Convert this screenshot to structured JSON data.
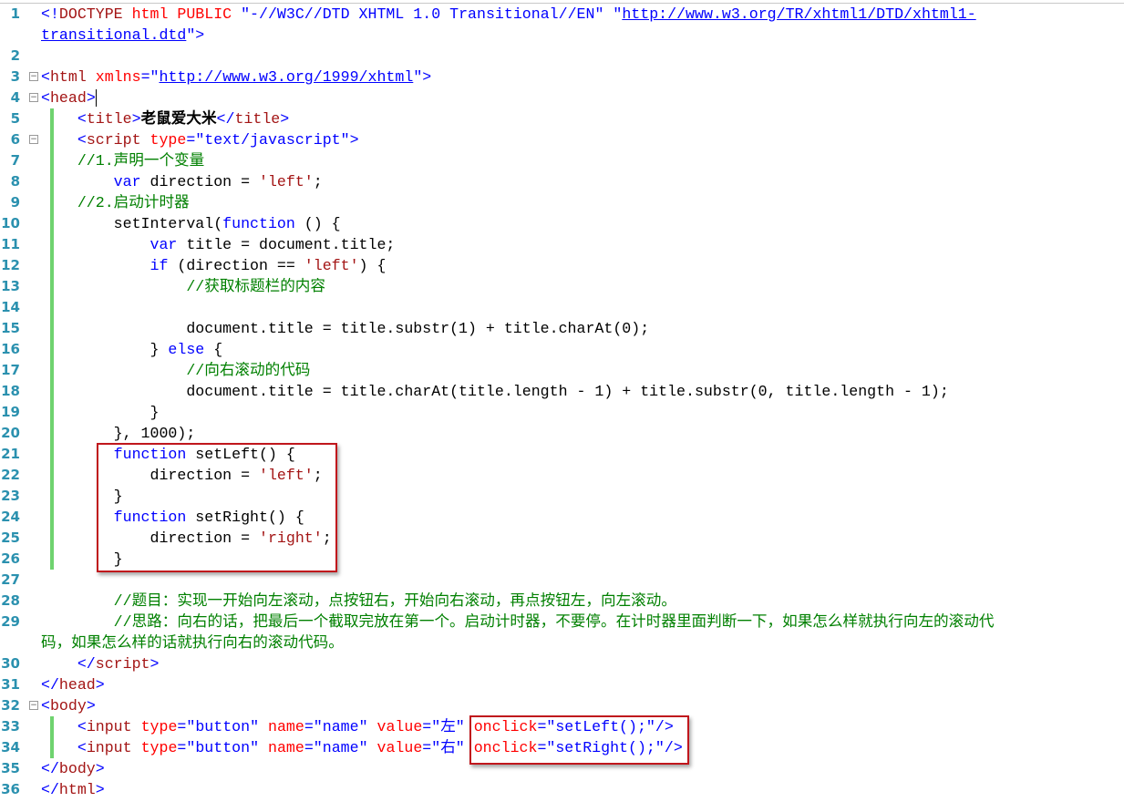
{
  "editor": {
    "lines": [
      {
        "n": "1",
        "rows": [
          [
            [
              "t",
              "<!"
            ],
            [
              "tn",
              "DOCTYPE"
            ],
            [
              "an",
              " html PUBLIC"
            ],
            [
              "av",
              " \"-//W3C//DTD XHTML 1.0 Transitional//EN\" \""
            ],
            [
              "url",
              "http://www.w3.org/TR/xhtml1/DTD/xhtml1-"
            ]
          ],
          [
            [
              "url",
              "transitional.dtd"
            ],
            [
              "av",
              "\""
            ],
            [
              "t",
              ">"
            ]
          ]
        ]
      },
      {
        "n": "2",
        "rows": [
          []
        ]
      },
      {
        "n": "3",
        "fold": true,
        "rows": [
          [
            [
              "t",
              "<"
            ],
            [
              "tn",
              "html"
            ],
            [
              "an",
              " xmlns"
            ],
            [
              "av",
              "=\""
            ],
            [
              "url",
              "http://www.w3.org/1999/xhtml"
            ],
            [
              "av",
              "\""
            ],
            [
              "t",
              ">"
            ]
          ]
        ]
      },
      {
        "n": "4",
        "fold": true,
        "caret": true,
        "rows": [
          [
            [
              "t",
              "<"
            ],
            [
              "tn",
              "head"
            ],
            [
              "t",
              ">"
            ]
          ]
        ]
      },
      {
        "n": "5",
        "chg": true,
        "rows": [
          [
            [
              "p",
              "    "
            ],
            [
              "t",
              "<"
            ],
            [
              "tn",
              "title"
            ],
            [
              "t",
              ">"
            ],
            [
              "b",
              "老鼠爱大米"
            ],
            [
              "t",
              "</"
            ],
            [
              "tn",
              "title"
            ],
            [
              "t",
              ">"
            ]
          ]
        ]
      },
      {
        "n": "6",
        "chg": true,
        "fold": true,
        "rows": [
          [
            [
              "p",
              "    "
            ],
            [
              "t",
              "<"
            ],
            [
              "tn",
              "script"
            ],
            [
              "an",
              " type"
            ],
            [
              "av",
              "=\"text/javascript\""
            ],
            [
              "t",
              ">"
            ]
          ]
        ]
      },
      {
        "n": "7",
        "chg": true,
        "rows": [
          [
            [
              "p",
              "    "
            ],
            [
              "c",
              "//1.声明一个变量"
            ]
          ]
        ]
      },
      {
        "n": "8",
        "chg": true,
        "rows": [
          [
            [
              "p",
              "        "
            ],
            [
              "kw",
              "var"
            ],
            [
              "p",
              " direction = "
            ],
            [
              "s",
              "'left'"
            ],
            [
              "p",
              ";"
            ]
          ]
        ]
      },
      {
        "n": "9",
        "chg": true,
        "rows": [
          [
            [
              "p",
              "    "
            ],
            [
              "c",
              "//2.启动计时器"
            ]
          ]
        ]
      },
      {
        "n": "10",
        "chg": true,
        "rows": [
          [
            [
              "p",
              "        setInterval("
            ],
            [
              "kw",
              "function"
            ],
            [
              "p",
              " () {"
            ]
          ]
        ]
      },
      {
        "n": "11",
        "chg": true,
        "rows": [
          [
            [
              "p",
              "            "
            ],
            [
              "kw",
              "var"
            ],
            [
              "p",
              " title = document.title;"
            ]
          ]
        ]
      },
      {
        "n": "12",
        "chg": true,
        "rows": [
          [
            [
              "p",
              "            "
            ],
            [
              "kw",
              "if"
            ],
            [
              "p",
              " (direction == "
            ],
            [
              "s",
              "'left'"
            ],
            [
              "p",
              ") {"
            ]
          ]
        ]
      },
      {
        "n": "13",
        "chg": true,
        "rows": [
          [
            [
              "p",
              "                "
            ],
            [
              "c",
              "//获取标题栏的内容"
            ]
          ]
        ]
      },
      {
        "n": "14",
        "chg": true,
        "rows": [
          []
        ]
      },
      {
        "n": "15",
        "chg": true,
        "rows": [
          [
            [
              "p",
              "                document.title = title.substr(1) + title.charAt(0);"
            ]
          ]
        ]
      },
      {
        "n": "16",
        "chg": true,
        "rows": [
          [
            [
              "p",
              "            } "
            ],
            [
              "kw",
              "else"
            ],
            [
              "p",
              " {"
            ]
          ]
        ]
      },
      {
        "n": "17",
        "chg": true,
        "rows": [
          [
            [
              "p",
              "                "
            ],
            [
              "c",
              "//向右滚动的代码"
            ]
          ]
        ]
      },
      {
        "n": "18",
        "chg": true,
        "rows": [
          [
            [
              "p",
              "                document.title = title.charAt(title.length - 1) + title.substr(0, title.length - 1);"
            ]
          ]
        ]
      },
      {
        "n": "19",
        "chg": true,
        "rows": [
          [
            [
              "p",
              "            }"
            ]
          ]
        ]
      },
      {
        "n": "20",
        "chg": true,
        "rows": [
          [
            [
              "p",
              "        }, 1000);"
            ]
          ]
        ]
      },
      {
        "n": "21",
        "chg": true,
        "rows": [
          [
            [
              "p",
              "        "
            ],
            [
              "kw",
              "function"
            ],
            [
              "p",
              " setLeft() {"
            ]
          ]
        ]
      },
      {
        "n": "22",
        "chg": true,
        "rows": [
          [
            [
              "p",
              "            direction = "
            ],
            [
              "s",
              "'left'"
            ],
            [
              "p",
              ";"
            ]
          ]
        ]
      },
      {
        "n": "23",
        "chg": true,
        "rows": [
          [
            [
              "p",
              "        }"
            ]
          ]
        ]
      },
      {
        "n": "24",
        "chg": true,
        "rows": [
          [
            [
              "p",
              "        "
            ],
            [
              "kw",
              "function"
            ],
            [
              "p",
              " setRight() {"
            ]
          ]
        ]
      },
      {
        "n": "25",
        "chg": true,
        "rows": [
          [
            [
              "p",
              "            direction = "
            ],
            [
              "s",
              "'right'"
            ],
            [
              "p",
              ";"
            ]
          ]
        ]
      },
      {
        "n": "26",
        "chg": true,
        "rows": [
          [
            [
              "p",
              "        }"
            ]
          ]
        ]
      },
      {
        "n": "27",
        "rows": [
          []
        ]
      },
      {
        "n": "28",
        "rows": [
          [
            [
              "p",
              "        "
            ],
            [
              "c",
              "//题目：实现一开始向左滚动，点按钮右，开始向右滚动，再点按钮左，向左滚动。"
            ]
          ]
        ]
      },
      {
        "n": "29",
        "rows": [
          [
            [
              "p",
              "        "
            ],
            [
              "c",
              "//思路：向右的话，把最后一个截取完放在第一个。启动计时器，不要停。在计时器里面判断一下，如果怎么样就执行向左的滚动代"
            ]
          ],
          [
            [
              "c",
              "码，如果怎么样的话就执行向右的滚动代码。"
            ]
          ]
        ]
      },
      {
        "n": "30",
        "rows": [
          [
            [
              "p",
              "    "
            ],
            [
              "t",
              "</"
            ],
            [
              "tn",
              "script"
            ],
            [
              "t",
              ">"
            ]
          ]
        ]
      },
      {
        "n": "31",
        "rows": [
          [
            [
              "t",
              "</"
            ],
            [
              "tn",
              "head"
            ],
            [
              "t",
              ">"
            ]
          ]
        ]
      },
      {
        "n": "32",
        "fold": true,
        "rows": [
          [
            [
              "t",
              "<"
            ],
            [
              "tn",
              "body"
            ],
            [
              "t",
              ">"
            ]
          ]
        ]
      },
      {
        "n": "33",
        "chg": true,
        "rows": [
          [
            [
              "p",
              "    "
            ],
            [
              "t",
              "<"
            ],
            [
              "tn",
              "input"
            ],
            [
              "an",
              " type"
            ],
            [
              "av",
              "=\"button\""
            ],
            [
              "an",
              " name"
            ],
            [
              "av",
              "=\"name\""
            ],
            [
              "an",
              " value"
            ],
            [
              "av",
              "=\"左\""
            ],
            [
              "an",
              " onclick"
            ],
            [
              "av",
              "=\"setLeft();\""
            ],
            [
              "t",
              "/>"
            ]
          ]
        ]
      },
      {
        "n": "34",
        "chg": true,
        "rows": [
          [
            [
              "p",
              "    "
            ],
            [
              "t",
              "<"
            ],
            [
              "tn",
              "input"
            ],
            [
              "an",
              " type"
            ],
            [
              "av",
              "=\"button\""
            ],
            [
              "an",
              " name"
            ],
            [
              "av",
              "=\"name\""
            ],
            [
              "an",
              " value"
            ],
            [
              "av",
              "=\"右\""
            ],
            [
              "an",
              " onclick"
            ],
            [
              "av",
              "=\"setRight();\""
            ],
            [
              "t",
              "/>"
            ]
          ]
        ]
      },
      {
        "n": "35",
        "rows": [
          [
            [
              "t",
              "</"
            ],
            [
              "tn",
              "body"
            ],
            [
              "t",
              ">"
            ]
          ]
        ]
      },
      {
        "n": "36",
        "rows": [
          [
            [
              "t",
              "</"
            ],
            [
              "tn",
              "html"
            ],
            [
              "t",
              ">"
            ]
          ]
        ]
      }
    ]
  }
}
